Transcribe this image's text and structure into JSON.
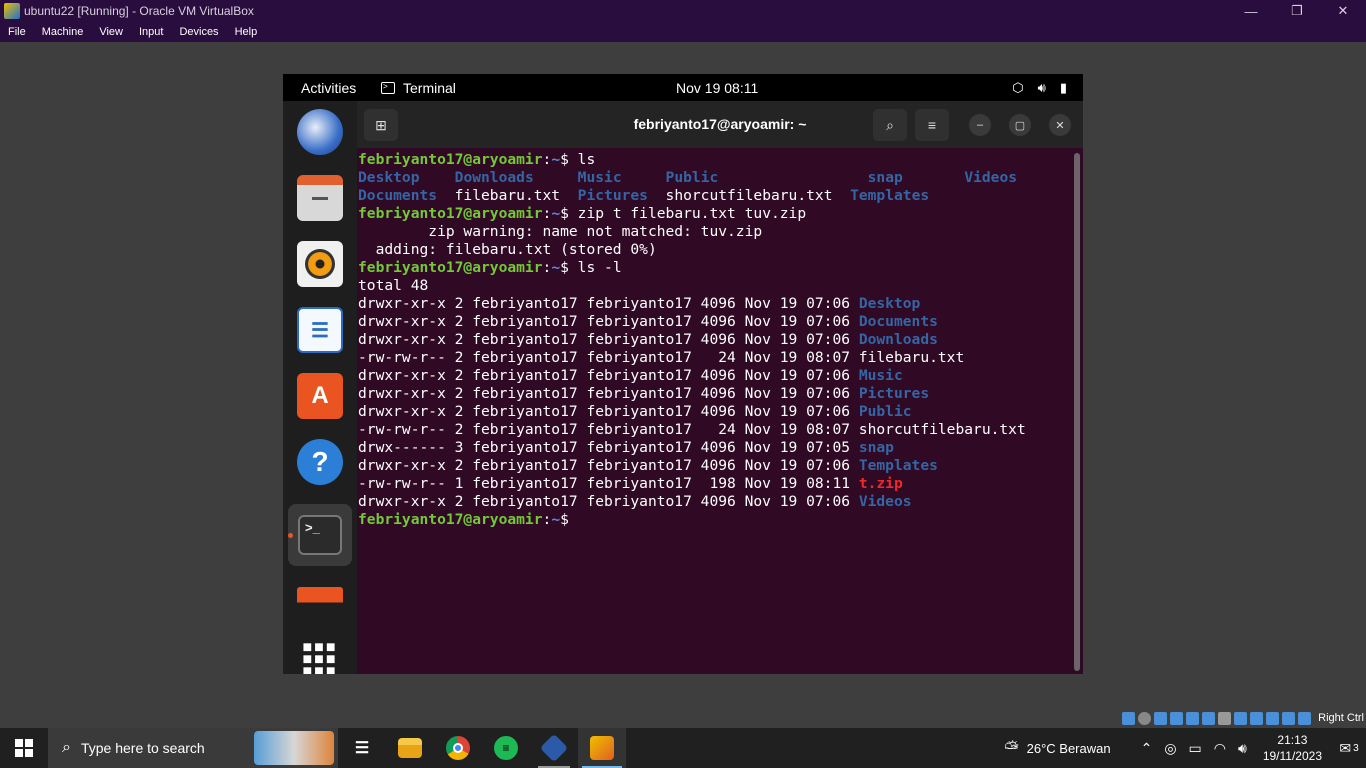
{
  "vbox": {
    "title": "ubuntu22 [Running] - Oracle VM VirtualBox",
    "menu": [
      "File",
      "Machine",
      "View",
      "Input",
      "Devices",
      "Help"
    ],
    "controls": {
      "minimize": "—",
      "restore": "❐",
      "close": "✕"
    },
    "host_key": "Right Ctrl"
  },
  "gnome": {
    "activities": "Activities",
    "app_name": "Terminal",
    "clock": "Nov 19  08:11",
    "tray_icons": [
      "network-icon",
      "volume-icon",
      "battery-icon"
    ]
  },
  "dock": {
    "items": [
      "thunderbird",
      "files",
      "rhythmbox",
      "libreoffice-writer",
      "app-center",
      "help",
      "terminal",
      "disk",
      "show-apps"
    ]
  },
  "terminal": {
    "title": "febriyanto17@aryoamir: ~",
    "prompt_user": "febriyanto17@aryoamir",
    "prompt_path": "~",
    "lines": [
      {
        "type": "cmd",
        "text": "ls"
      },
      {
        "type": "raw",
        "segments": [
          {
            "c": "dir",
            "t": "Desktop    "
          },
          {
            "c": "dir",
            "t": "Downloads     "
          },
          {
            "c": "dir",
            "t": "Music     "
          },
          {
            "c": "dir",
            "t": "Public"
          },
          {
            "c": "",
            "t": "                 "
          },
          {
            "c": "dir",
            "t": "snap"
          },
          {
            "c": "",
            "t": "       "
          },
          {
            "c": "dir",
            "t": "Videos"
          }
        ]
      },
      {
        "type": "raw",
        "segments": [
          {
            "c": "dir",
            "t": "Documents"
          },
          {
            "c": "",
            "t": "  filebaru.txt  "
          },
          {
            "c": "dir",
            "t": "Pictures"
          },
          {
            "c": "",
            "t": "  shorcutfilebaru.txt  "
          },
          {
            "c": "dir",
            "t": "Templates"
          }
        ]
      },
      {
        "type": "cmd",
        "text": "zip t filebaru.txt tuv.zip"
      },
      {
        "type": "raw",
        "segments": [
          {
            "c": "",
            "t": "        zip warning: name not matched: tuv.zip"
          }
        ]
      },
      {
        "type": "raw",
        "segments": [
          {
            "c": "",
            "t": "  adding: filebaru.txt (stored 0%)"
          }
        ]
      },
      {
        "type": "cmd",
        "text": "ls -l"
      },
      {
        "type": "raw",
        "segments": [
          {
            "c": "",
            "t": "total 48"
          }
        ]
      },
      {
        "type": "raw",
        "segments": [
          {
            "c": "",
            "t": "drwxr-xr-x 2 febriyanto17 febriyanto17 4096 Nov 19 07:06 "
          },
          {
            "c": "dir",
            "t": "Desktop"
          }
        ]
      },
      {
        "type": "raw",
        "segments": [
          {
            "c": "",
            "t": "drwxr-xr-x 2 febriyanto17 febriyanto17 4096 Nov 19 07:06 "
          },
          {
            "c": "dir",
            "t": "Documents"
          }
        ]
      },
      {
        "type": "raw",
        "segments": [
          {
            "c": "",
            "t": "drwxr-xr-x 2 febriyanto17 febriyanto17 4096 Nov 19 07:06 "
          },
          {
            "c": "dir",
            "t": "Downloads"
          }
        ]
      },
      {
        "type": "raw",
        "segments": [
          {
            "c": "",
            "t": "-rw-rw-r-- 2 febriyanto17 febriyanto17   24 Nov 19 08:07 filebaru.txt"
          }
        ]
      },
      {
        "type": "raw",
        "segments": [
          {
            "c": "",
            "t": "drwxr-xr-x 2 febriyanto17 febriyanto17 4096 Nov 19 07:06 "
          },
          {
            "c": "dir",
            "t": "Music"
          }
        ]
      },
      {
        "type": "raw",
        "segments": [
          {
            "c": "",
            "t": "drwxr-xr-x 2 febriyanto17 febriyanto17 4096 Nov 19 07:06 "
          },
          {
            "c": "dir",
            "t": "Pictures"
          }
        ]
      },
      {
        "type": "raw",
        "segments": [
          {
            "c": "",
            "t": "drwxr-xr-x 2 febriyanto17 febriyanto17 4096 Nov 19 07:06 "
          },
          {
            "c": "dir",
            "t": "Public"
          }
        ]
      },
      {
        "type": "raw",
        "segments": [
          {
            "c": "",
            "t": "-rw-rw-r-- 2 febriyanto17 febriyanto17   24 Nov 19 08:07 shorcutfilebaru.txt"
          }
        ]
      },
      {
        "type": "raw",
        "segments": [
          {
            "c": "",
            "t": "drwx------ 3 febriyanto17 febriyanto17 4096 Nov 19 07:05 "
          },
          {
            "c": "dir",
            "t": "snap"
          }
        ]
      },
      {
        "type": "raw",
        "segments": [
          {
            "c": "",
            "t": "drwxr-xr-x 2 febriyanto17 febriyanto17 4096 Nov 19 07:06 "
          },
          {
            "c": "dir",
            "t": "Templates"
          }
        ]
      },
      {
        "type": "raw",
        "segments": [
          {
            "c": "",
            "t": "-rw-rw-r-- 1 febriyanto17 febriyanto17  198 Nov 19 08:11 "
          },
          {
            "c": "zip",
            "t": "t.zip"
          }
        ]
      },
      {
        "type": "raw",
        "segments": [
          {
            "c": "",
            "t": "drwxr-xr-x 2 febriyanto17 febriyanto17 4096 Nov 19 07:06 "
          },
          {
            "c": "dir",
            "t": "Videos"
          }
        ]
      },
      {
        "type": "cmd",
        "text": ""
      }
    ]
  },
  "taskbar": {
    "search_placeholder": "Type here to search",
    "weather": "26°C  Berawan",
    "time": "21:13",
    "date": "19/11/2023",
    "notifications": "3",
    "colors": {
      "bg": "#202020",
      "accent": "#76b9ed"
    }
  }
}
